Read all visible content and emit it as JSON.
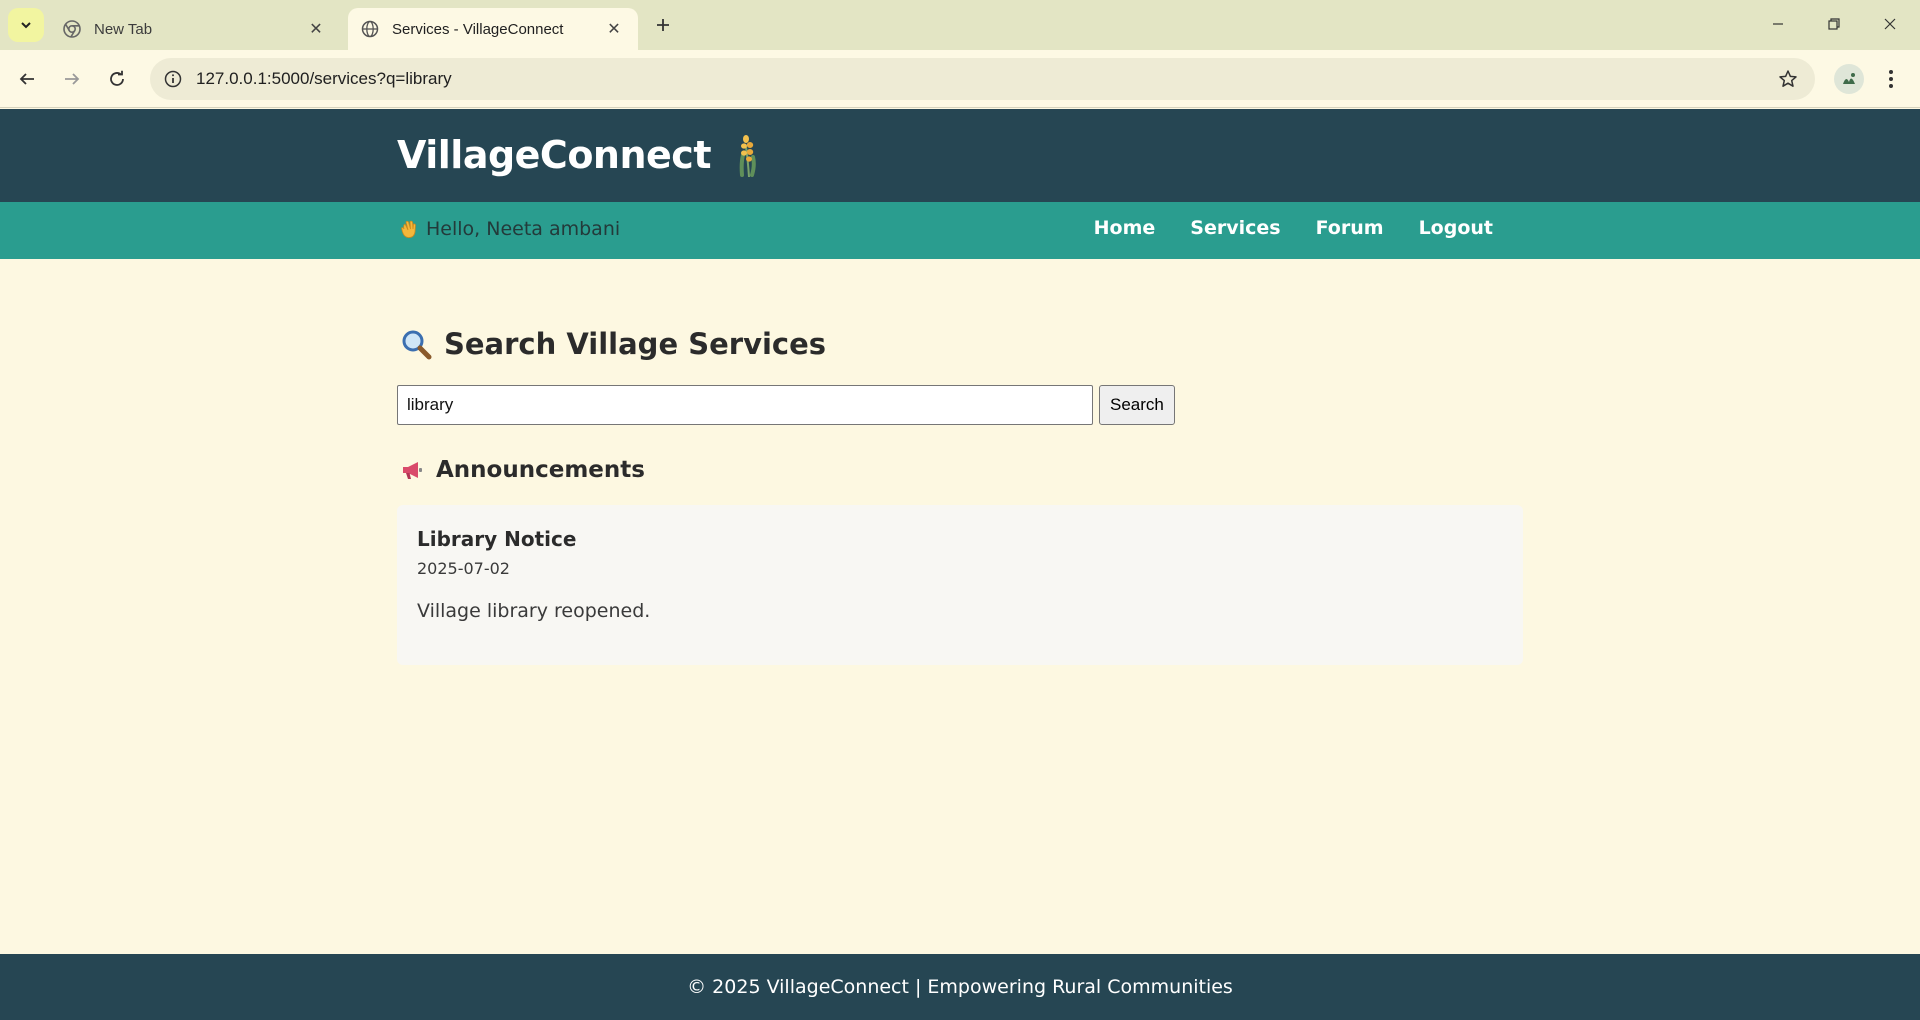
{
  "browser": {
    "tabs": [
      {
        "title": "New Tab",
        "active": false
      },
      {
        "title": "Services - VillageConnect",
        "active": true
      }
    ],
    "url": "127.0.0.1:5000/services?q=library"
  },
  "site": {
    "brand": "VillageConnect",
    "greeting": "Hello, Neeta ambani",
    "nav": [
      "Home",
      "Services",
      "Forum",
      "Logout"
    ],
    "colors": {
      "header": "#264653",
      "subnav": "#2a9d8f",
      "background": "#fdf8e1"
    }
  },
  "search": {
    "heading": "Search Village Services",
    "query": "library",
    "button_label": "Search"
  },
  "announcements": {
    "heading": "Announcements",
    "items": [
      {
        "title": "Library Notice",
        "date": "2025-07-02",
        "body": "Village library reopened."
      }
    ]
  },
  "footer": {
    "text": "© 2025 VillageConnect | Empowering Rural Communities"
  }
}
